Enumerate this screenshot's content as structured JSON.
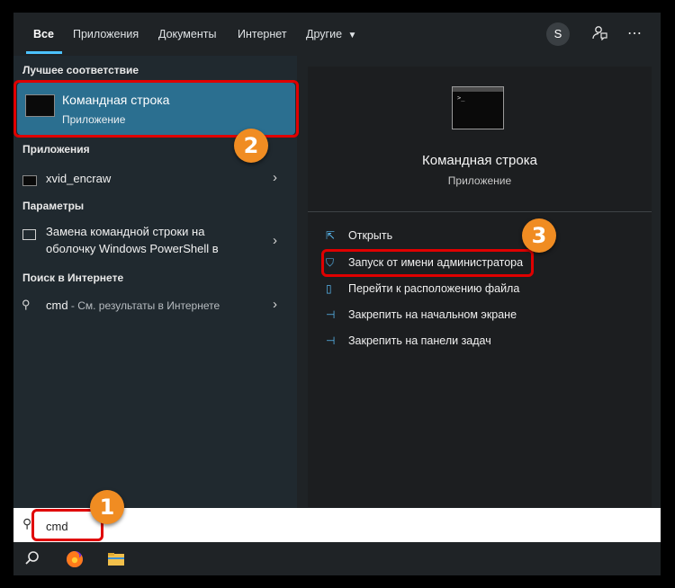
{
  "tabs": [
    "Все",
    "Приложения",
    "Документы",
    "Интернет",
    "Другие"
  ],
  "avatar_letter": "S",
  "sections": {
    "best_match": "Лучшее соответствие",
    "apps": "Приложения",
    "settings": "Параметры",
    "web": "Поиск в Интернете"
  },
  "best": {
    "title": "Командная строка",
    "subtitle": "Приложение"
  },
  "apps": [
    {
      "label": "xvid_encraw"
    }
  ],
  "settings": [
    {
      "line1": "Замена командной строки на",
      "line2": "оболочку Windows PowerShell в"
    }
  ],
  "web": {
    "query": "cmd",
    "suffix": " - См. результаты в Интернете"
  },
  "preview": {
    "title": "Командная строка",
    "subtitle": "Приложение",
    "actions": [
      "Открыть",
      "Запуск от имени администратора",
      "Перейти к расположению файла",
      "Закрепить на начальном экране",
      "Закрепить на панели задач"
    ]
  },
  "search": {
    "value": "cmd"
  },
  "badges": [
    "1",
    "2",
    "3"
  ],
  "colors": {
    "accent": "#4cc2ff",
    "highlight": "#2b6f90",
    "annotation": "#e00000",
    "badge": "#f08c22"
  }
}
